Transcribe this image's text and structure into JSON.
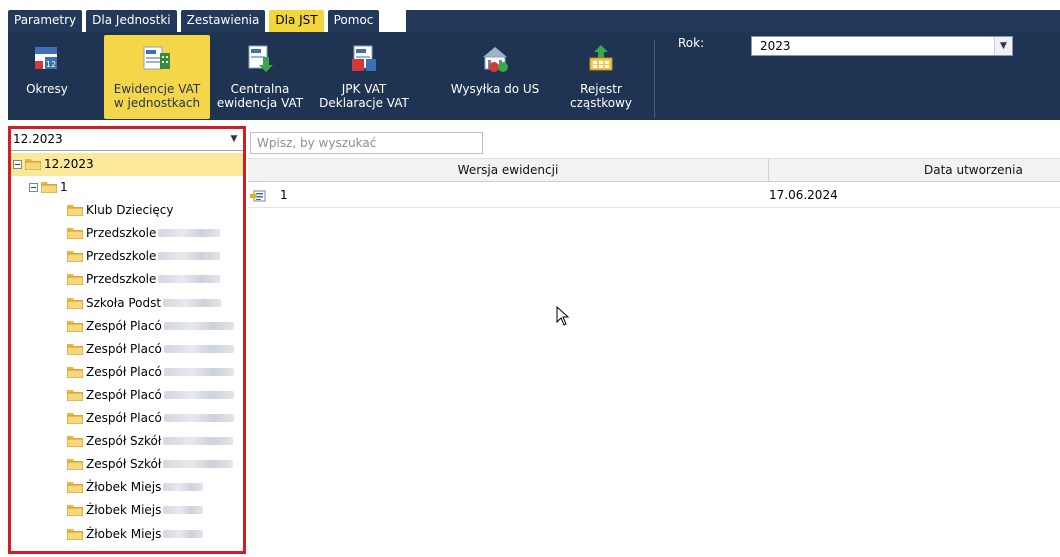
{
  "menu": {
    "tabs": [
      {
        "label": "Parametry",
        "active": false
      },
      {
        "label": "Dla Jednostki",
        "active": false
      },
      {
        "label": "Zestawienia",
        "active": false
      },
      {
        "label": "Dla JST",
        "active": true
      },
      {
        "label": "Pomoc",
        "active": false
      }
    ]
  },
  "ribbon": {
    "buttons": [
      {
        "label_1": "Okresy",
        "label_2": "",
        "icon": "calendar-vat-icon",
        "active": false
      },
      {
        "label_1": "Ewidencje VAT",
        "label_2": "w jednostkach",
        "icon": "vat-units-icon",
        "active": true
      },
      {
        "label_1": "Centralna",
        "label_2": "ewidencja VAT",
        "icon": "vat-central-icon",
        "active": false
      },
      {
        "label_1": "JPK VAT",
        "label_2": "Deklaracje VAT",
        "icon": "vat-declaration-icon",
        "active": false
      },
      {
        "label_1": "Wysyłka do US",
        "label_2": "",
        "icon": "vat-send-icon",
        "active": false
      },
      {
        "label_1": "Rejestr",
        "label_2": "cząstkowy",
        "icon": "partial-register-icon",
        "active": false
      }
    ],
    "year_label": "Rok:",
    "year_value": "2023"
  },
  "left_panel": {
    "period_value": "12.2023",
    "tree": [
      {
        "label": "12.2023",
        "level": 0,
        "expandable": true,
        "selected": true
      },
      {
        "label": "1",
        "level": 1,
        "expandable": true,
        "selected": false
      },
      {
        "label": "Klub Dziecięcy",
        "level": 2,
        "expandable": false,
        "selected": false
      },
      {
        "label": "Przedszkole",
        "level": 2,
        "expandable": false,
        "selected": false
      },
      {
        "label": "Przedszkole",
        "level": 2,
        "expandable": false,
        "selected": false
      },
      {
        "label": "Przedszkole",
        "level": 2,
        "expandable": false,
        "selected": false
      },
      {
        "label": "Szkoła Podst",
        "level": 2,
        "expandable": false,
        "selected": false
      },
      {
        "label": "Zespół Placó",
        "level": 2,
        "expandable": false,
        "selected": false
      },
      {
        "label": "Zespół Placó",
        "level": 2,
        "expandable": false,
        "selected": false
      },
      {
        "label": "Zespół Placó",
        "level": 2,
        "expandable": false,
        "selected": false
      },
      {
        "label": "Zespół Placó",
        "level": 2,
        "expandable": false,
        "selected": false
      },
      {
        "label": "Zespół Placó",
        "level": 2,
        "expandable": false,
        "selected": false
      },
      {
        "label": "Zespół Szkół",
        "level": 2,
        "expandable": false,
        "selected": false
      },
      {
        "label": "Zespół Szkół",
        "level": 2,
        "expandable": false,
        "selected": false
      },
      {
        "label": "Żłobek Miejs",
        "level": 2,
        "expandable": false,
        "selected": false
      },
      {
        "label": "Żłobek Miejs",
        "level": 2,
        "expandable": false,
        "selected": false
      },
      {
        "label": "Żłobek Miejs",
        "level": 2,
        "expandable": false,
        "selected": false
      }
    ]
  },
  "search": {
    "placeholder": "Wpisz, by wyszukać"
  },
  "grid": {
    "columns": [
      "Wersja ewidencji",
      "Data utworzenia"
    ],
    "rows": [
      {
        "version": "1",
        "created": "17.06.2024"
      }
    ]
  },
  "colors": {
    "ribbon_bg": "#1f3453",
    "active_tab": "#f3d63b",
    "highlight_border": "#cf1f24",
    "tree_selected": "#fae99a"
  }
}
